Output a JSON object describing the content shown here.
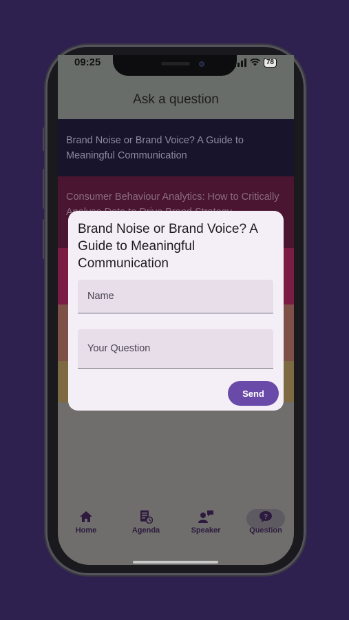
{
  "status_bar": {
    "time": "09:25",
    "battery": "78"
  },
  "appbar": {
    "title": "Ask a question"
  },
  "list": [
    {
      "title": "Brand Noise or Brand Voice? A Guide to Meaningful Communication"
    },
    {
      "title": "Consumer Behaviour Analytics: How to Critically Analyse Data to Drive Brand Strategy"
    }
  ],
  "dialog": {
    "title": "Brand Noise or Brand Voice? A Guide to Meaningful Communication",
    "name_placeholder": "Name",
    "question_placeholder": "Your Question",
    "send_label": "Send"
  },
  "bottom_nav": [
    {
      "label": "Home",
      "icon": "home-icon"
    },
    {
      "label": "Agenda",
      "icon": "agenda-icon"
    },
    {
      "label": "Speaker",
      "icon": "speaker-icon"
    },
    {
      "label": "Question",
      "icon": "question-icon",
      "active": true
    }
  ],
  "colors": {
    "background": "#2e2150",
    "accent": "#6a4aa8",
    "dialog": "#f4eff7"
  }
}
